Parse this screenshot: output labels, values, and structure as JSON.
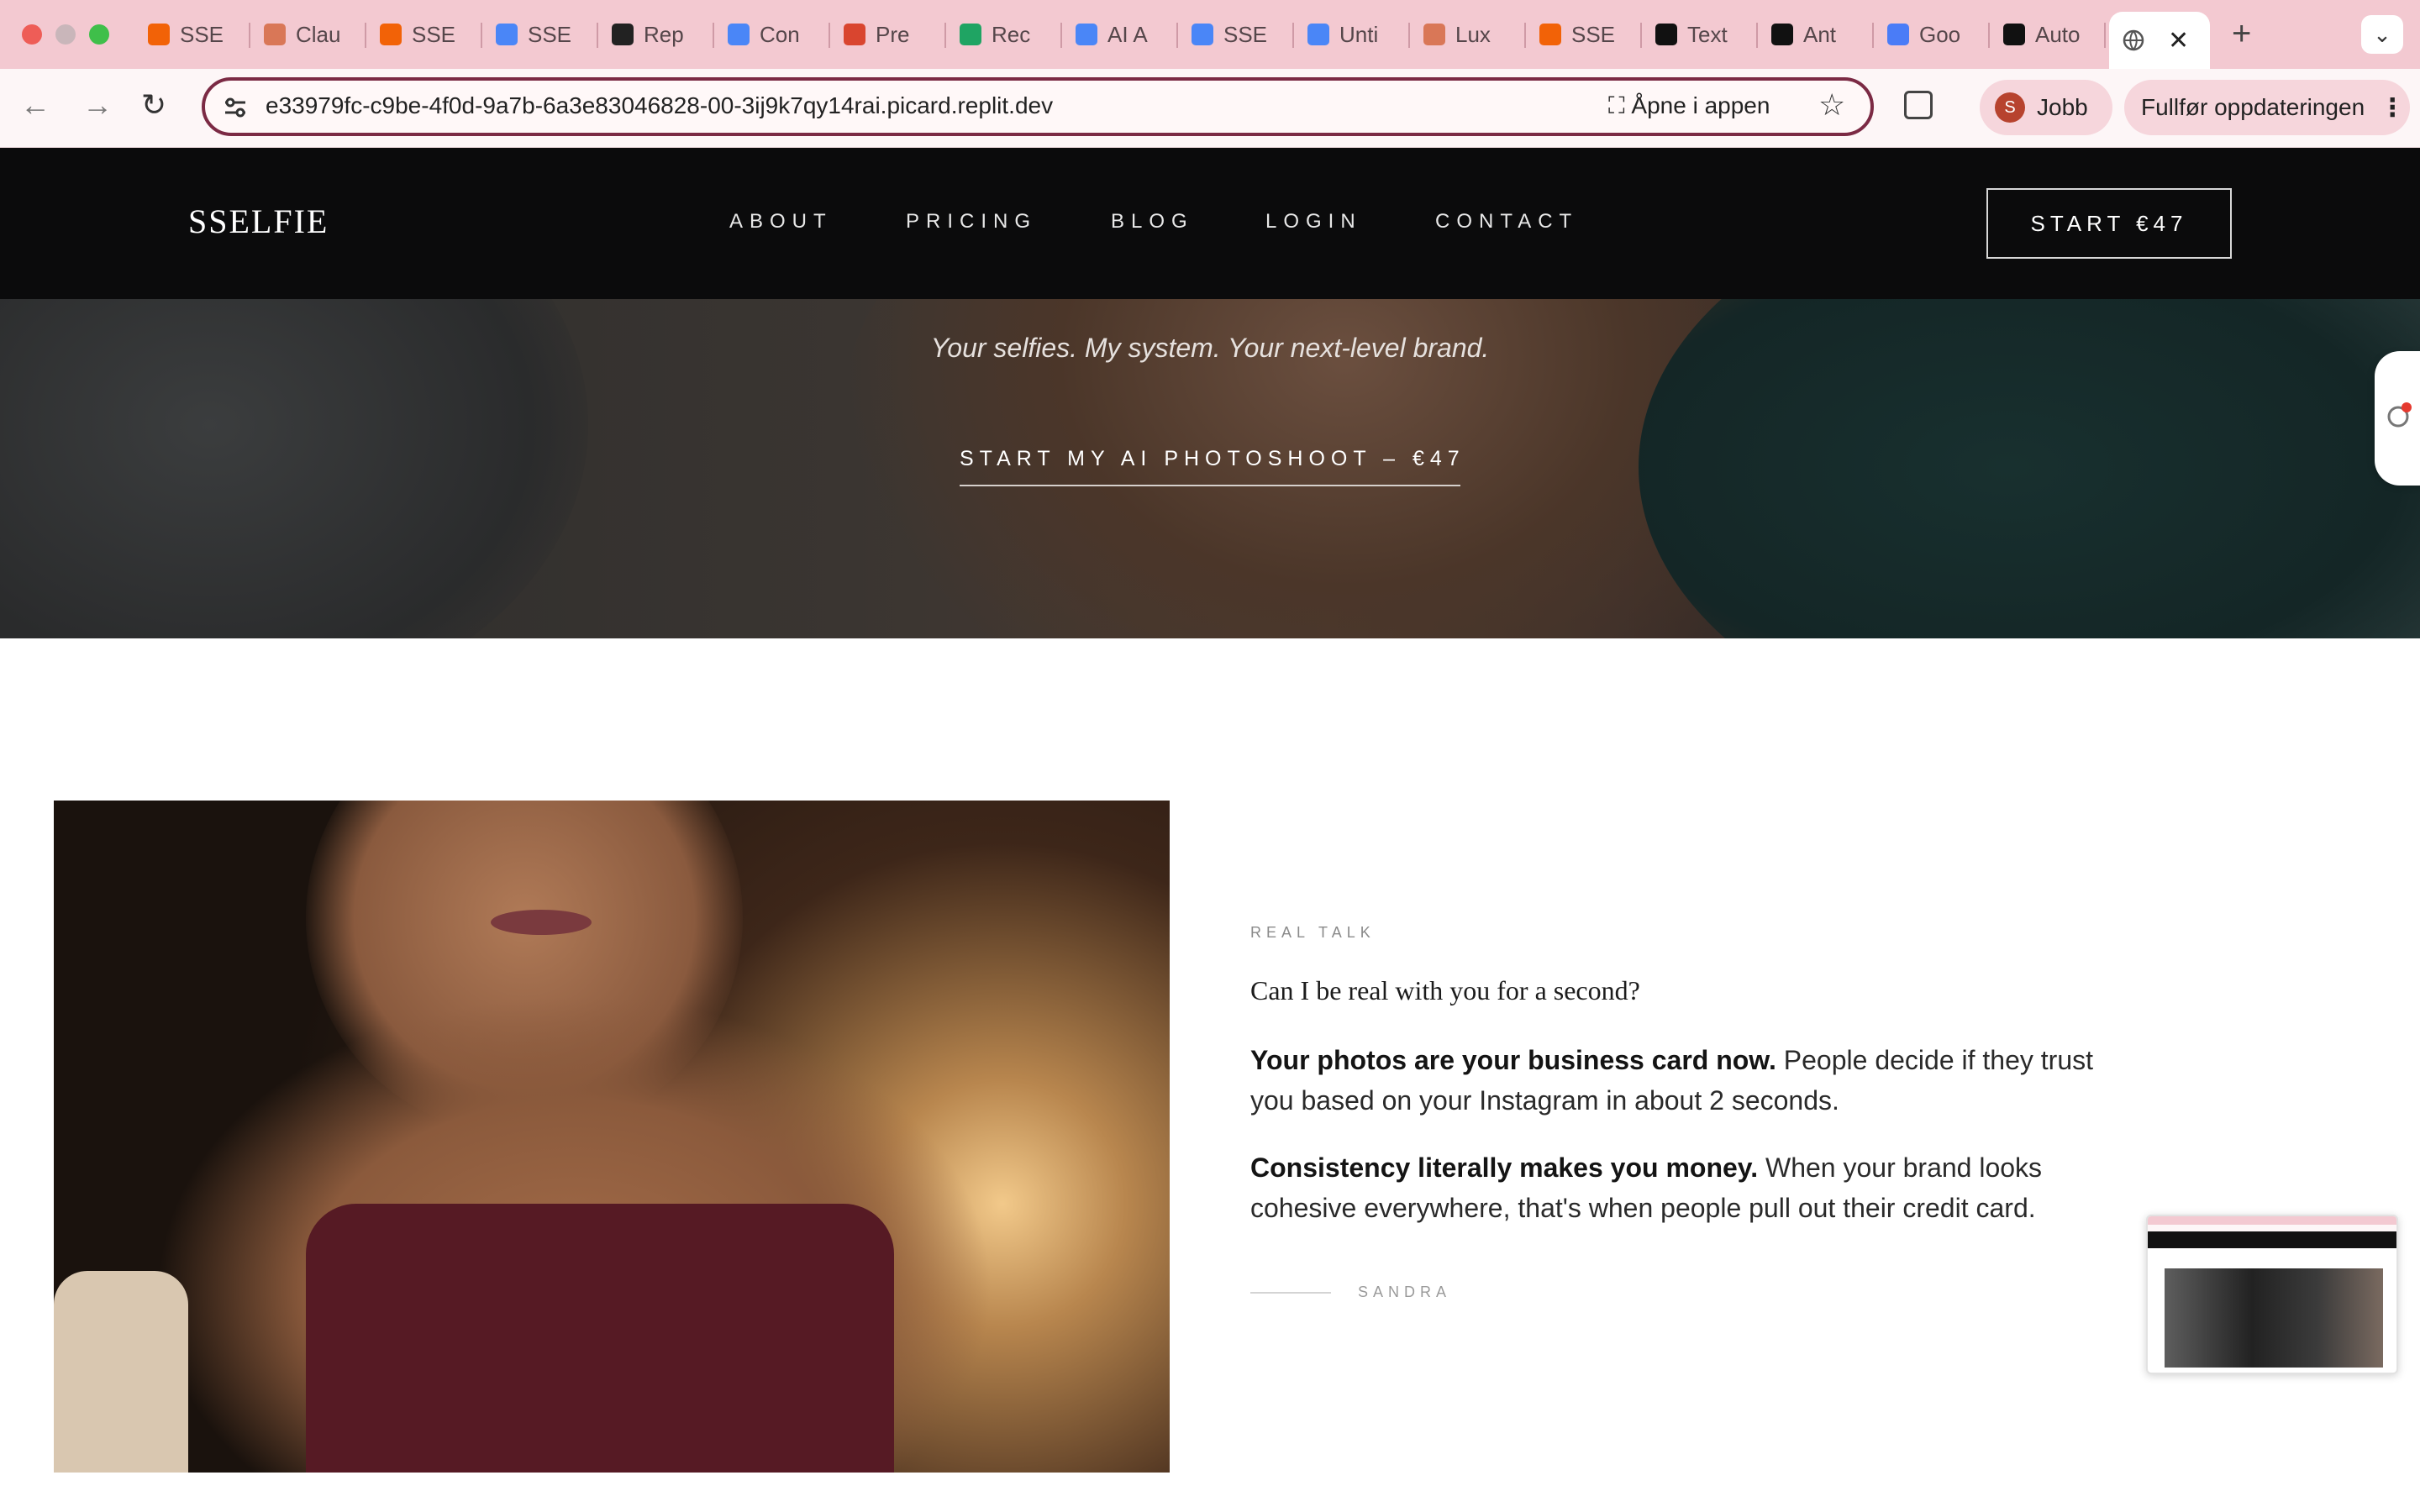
{
  "browser": {
    "tabs": [
      {
        "label": "SSE",
        "icon": "replit-icon",
        "color": "#f26207"
      },
      {
        "label": "Clau",
        "icon": "claude-icon",
        "color": "#d97757"
      },
      {
        "label": "SSE",
        "icon": "replit-icon",
        "color": "#f26207"
      },
      {
        "label": "SSE",
        "icon": "google-docs-icon",
        "color": "#4a86f7"
      },
      {
        "label": "Rep",
        "icon": "openai-icon",
        "color": "#222222"
      },
      {
        "label": "Con",
        "icon": "google-docs-icon",
        "color": "#4a86f7"
      },
      {
        "label": "Pre",
        "icon": "slides-icon",
        "color": "#d9452f"
      },
      {
        "label": "Rec",
        "icon": "google-drive-icon",
        "color": "#1fa463"
      },
      {
        "label": "AI A",
        "icon": "google-docs-icon",
        "color": "#4a86f7"
      },
      {
        "label": "SSE",
        "icon": "google-docs-icon",
        "color": "#4a86f7"
      },
      {
        "label": "Unti",
        "icon": "google-docs-icon",
        "color": "#4a86f7"
      },
      {
        "label": "Lux",
        "icon": "claude-icon",
        "color": "#d97757"
      },
      {
        "label": "SSE",
        "icon": "replit-icon",
        "color": "#f26207"
      },
      {
        "label": "Text",
        "icon": "pause-icon",
        "color": "#111111"
      },
      {
        "label": "Ant",
        "icon": "anthropic-icon",
        "color": "#111111"
      },
      {
        "label": "Goo",
        "icon": "gemini-icon",
        "color": "#4a7cf7"
      },
      {
        "label": "Auto",
        "icon": "circle-logo-icon",
        "color": "#111111"
      }
    ],
    "url": "e33979fc-c9be-4f0d-9a7b-6a3e83046828-00-3ij9k7qy14rai.picard.replit.dev",
    "open_in_app": "Åpne i appen",
    "profile_initial": "S",
    "profile_name": "Jobb",
    "update_label": "Fullfør oppdateringen"
  },
  "site": {
    "logo": "SSELFIE",
    "nav": [
      "ABOUT",
      "PRICING",
      "BLOG",
      "LOGIN",
      "CONTACT"
    ],
    "cta": "START €47",
    "hero": {
      "tagline": "Your selfies. My system. Your next-level brand.",
      "cta": "START MY AI PHOTOSHOOT – €47"
    },
    "section": {
      "eyebrow": "REAL TALK",
      "question": "Can I be real with you for a second?",
      "p1_bold": "Your photos are your business card now.",
      "p1_rest": " People decide if they trust you based on your Instagram in about 2 seconds.",
      "p2_bold": "Consistency literally makes you money.",
      "p2_rest": " When your brand looks cohesive everywhere, that's when people pull out their credit card.",
      "signature": "SANDRA"
    }
  }
}
